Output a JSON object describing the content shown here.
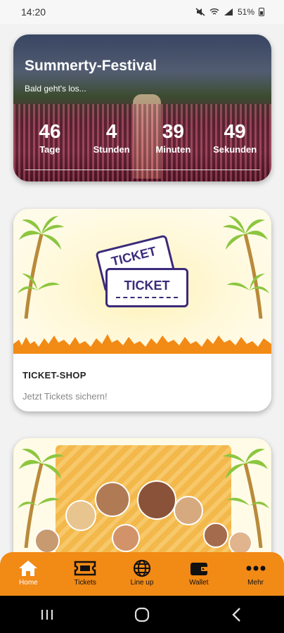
{
  "status": {
    "time": "14:20",
    "battery": "51%"
  },
  "festival": {
    "title": "Summerty-Festival",
    "subtitle": "Bald geht's los...",
    "countdown": [
      {
        "value": "46",
        "label": "Tage"
      },
      {
        "value": "4",
        "label": "Stunden"
      },
      {
        "value": "39",
        "label": "Minuten"
      },
      {
        "value": "49",
        "label": "Sekunden"
      }
    ]
  },
  "ticket_card": {
    "art_front": "TICKET",
    "art_back": "TICKET",
    "heading": "TICKET-SHOP",
    "subtitle": "Jetzt Tickets sichern!"
  },
  "nav": {
    "items": [
      {
        "label": "Home",
        "icon": "home-icon",
        "active": true
      },
      {
        "label": "Tickets",
        "icon": "ticket-icon",
        "active": false
      },
      {
        "label": "Line up",
        "icon": "globe-icon",
        "active": false
      },
      {
        "label": "Wallet",
        "icon": "wallet-icon",
        "active": false
      },
      {
        "label": "Mehr",
        "icon": "more-icon",
        "active": false
      }
    ]
  },
  "colors": {
    "accent": "#f28a16",
    "ticket_ink": "#3b2a7a"
  }
}
